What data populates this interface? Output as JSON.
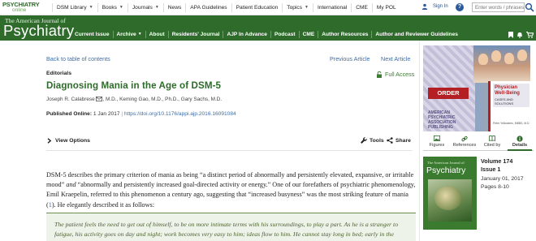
{
  "topbar": {
    "brand_line1": "PSYCHIATRY",
    "brand_line2": "online",
    "nav": [
      {
        "label": "DSM Library",
        "dropdown": true
      },
      {
        "label": "Books",
        "dropdown": true
      },
      {
        "label": "Journals",
        "dropdown": true
      },
      {
        "label": "News",
        "dropdown": false
      },
      {
        "label": "APA Guidelines",
        "dropdown": false
      },
      {
        "label": "Patient Education",
        "dropdown": false
      },
      {
        "label": "Topics",
        "dropdown": true
      },
      {
        "label": "International",
        "dropdown": false
      },
      {
        "label": "CME",
        "dropdown": false
      },
      {
        "label": "My POL",
        "dropdown": false
      }
    ],
    "sign_in": "Sign In",
    "help_symbol": "?",
    "search_placeholder": "Enter words / phrases"
  },
  "journal_header": {
    "subtitle": "The American Journal of",
    "title": "Psychiatry",
    "nav": [
      {
        "label": "Current Issue",
        "dropdown": false
      },
      {
        "label": "Archive",
        "dropdown": true
      },
      {
        "label": "About",
        "dropdown": false
      },
      {
        "label": "Residents' Journal",
        "dropdown": false
      },
      {
        "label": "AJP In Advance",
        "dropdown": false
      },
      {
        "label": "Podcast",
        "dropdown": false
      },
      {
        "label": "CME",
        "dropdown": false
      },
      {
        "label": "Author Resources",
        "dropdown": false
      },
      {
        "label": "Author and Reviewer Guidelines",
        "dropdown": false
      }
    ],
    "icons": [
      "bookmark-icon",
      "bell-icon",
      "shopping-cart-icon"
    ]
  },
  "article": {
    "back_link": "Back to table of contents",
    "previous": "Previous Article",
    "next": "Next Article",
    "category": "Editorials",
    "access": "Full Access",
    "title": "Diagnosing Mania in the Age of DSM-5",
    "authors": [
      {
        "name": "Joseph R. Calabrese",
        "suffix": ", M.D., "
      },
      {
        "name": "Keming Gao, M.D., Ph.D., ",
        "suffix": ""
      },
      {
        "name": "Gary Sachs, M.D.",
        "suffix": ""
      }
    ],
    "published_label": "Published Online:",
    "published_date": "1 Jan 2017",
    "doi": "https://doi.org/10.1176/appi.ajp.2016.16091084",
    "view_options": "View Options",
    "tools": "Tools",
    "share": "Share",
    "body_p1_a": "DSM-5 describes the primary criterion of mania as being “a distinct period of abnormally and persistently elevated, expansive, or irritable mood” ",
    "body_p1_and": "and",
    "body_p1_b": " “abnormally and persistently increased goal-directed activity or energy.” One of our forefathers of psychiatric phenomenology, Emil Kraepelin, referred to this phenomenon a century ago, suggesting that “increased busyness” was the most striking feature of mania (",
    "body_ref": "1",
    "body_p1_c": "). He elegantly described it as follows:",
    "quote": "The patient feels the need to get out of himself, to be on more intimate terms with his surroundings, to play a part. As he is a stranger to fatigue, his activity goes on day and night; work becomes very easy to him; ideas flow to him. He cannot stay long in bed; early in the"
  },
  "sidebar": {
    "ad": {
      "order_label": "ORDER",
      "publisher": "AMERICAN PSYCHIATRIC ASSOCIATION PUBLISHING",
      "book_title": "Physician Well-Being",
      "book_subtitle": "CASES AND SOLUTIONS",
      "book_author": "Peter Yellowlees, MBBS, M.D."
    },
    "tabs": [
      {
        "label": "Figures",
        "icon": "image-icon",
        "active": false
      },
      {
        "label": "References",
        "icon": "link-icon",
        "active": false
      },
      {
        "label": "Cited by",
        "icon": "book-icon",
        "active": false
      },
      {
        "label": "Details",
        "icon": "info-icon",
        "active": true
      }
    ],
    "cover_subtitle": "The American Journal of",
    "cover_title": "Psychiatry",
    "volume": "Volume 174",
    "issue": "Issue 1",
    "date": "January 01, 2017",
    "pages": "Pages 8-10"
  },
  "colors": {
    "brand_green": "#2f6c2c",
    "link_blue": "#3d6ea8",
    "order_red": "#b31f22"
  }
}
